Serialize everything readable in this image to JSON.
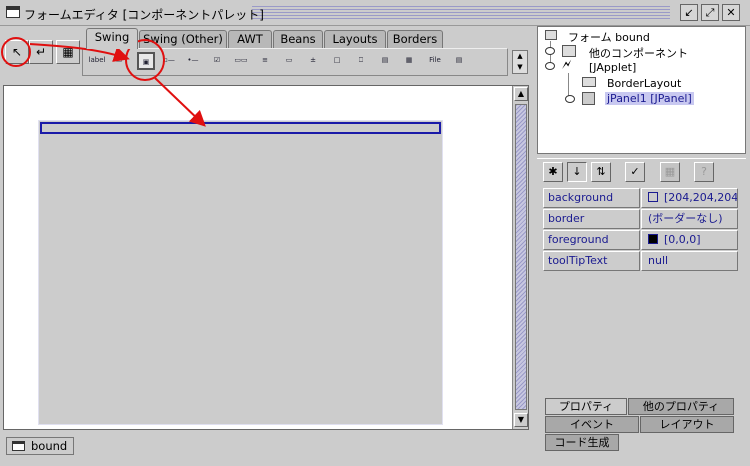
{
  "window": {
    "title": "フォームエディタ [コンポーネントパレット]",
    "controls": [
      "↙",
      "⤢",
      "✕"
    ]
  },
  "tools": {
    "selection": "↖",
    "connection": "↵",
    "add_mode": "▦"
  },
  "palette": {
    "tabs": [
      "Swing",
      "Swing (Other)",
      "AWT",
      "Beans",
      "Layouts",
      "Borders"
    ],
    "active_tab": "Swing",
    "items": [
      "label",
      "▭",
      "▣",
      "▫—",
      "•—",
      "☑",
      "▭▭",
      "≡",
      "▭",
      "±",
      "□",
      "⎕",
      "▤",
      "▦",
      "File",
      "▤"
    ]
  },
  "tree": {
    "root": "フォーム bound",
    "other": "他のコンポーネント",
    "applet": "[JApplet]",
    "layout": "BorderLayout",
    "panel": "jPanel1 [JPanel]"
  },
  "properties": [
    {
      "name": "background",
      "value": "[204,204,204]",
      "swatch": "#cccccc"
    },
    {
      "name": "border",
      "value": "(ボーダーなし)",
      "swatch": null
    },
    {
      "name": "foreground",
      "value": "[0,0,0]",
      "swatch": "#000000"
    },
    {
      "name": "toolTipText",
      "value": "null",
      "swatch": null
    }
  ],
  "property_tabs": {
    "properties": "プロパティ",
    "other_properties": "他のプロパティ",
    "events": "イベント",
    "layout": "レイアウト",
    "code_generation": "コード生成"
  },
  "bottom_tab": "bound",
  "colors": {
    "annotation": "#e01010",
    "selection": "#1a1aa8",
    "accent_text": "#1a1a90"
  }
}
